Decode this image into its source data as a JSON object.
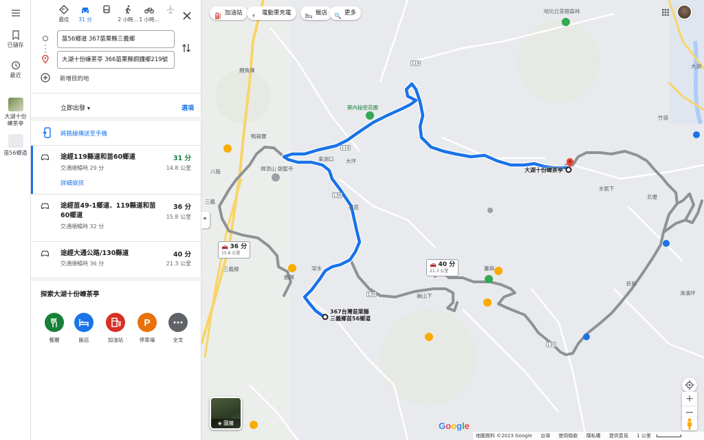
{
  "rail": {
    "saved": "已儲存",
    "recent": "最近",
    "recent_place_1": "大湖十份\n崠茶亭",
    "recent_place_2": "苗56鄉道"
  },
  "modes": [
    {
      "label": "最佳",
      "icon": "diamond-route-icon"
    },
    {
      "label": "31 分",
      "icon": "car-icon",
      "active": true
    },
    {
      "label": "",
      "icon": "bus-icon"
    },
    {
      "label": "2 小時...",
      "icon": "walk-icon"
    },
    {
      "label": "1 小時...",
      "icon": "bike-icon"
    },
    {
      "label": "",
      "icon": "plane-icon"
    }
  ],
  "waypoints": {
    "origin": "苗56鄉道 367苗栗縣三義鄉",
    "destination": "大湖十份崠茶亭 366苗栗縣銅鑼鄉219號",
    "add_destination": "新增目的地"
  },
  "depart": "立即出發",
  "options": "選項",
  "send_to_phone": "將路線傳送至手機",
  "routes": [
    {
      "title": "途經119縣道和苗60鄉道",
      "time": "31 分",
      "sub": "交通順暢時 29 分",
      "dist": "14.8 公里",
      "details": "詳細資訊"
    },
    {
      "title": "途經苗49-1鄉道、119縣道和苗60鄉道",
      "time": "36 分",
      "sub": "交通順暢時 32 分",
      "dist": "15.8 公里"
    },
    {
      "title": "途經大通公路/130縣道",
      "time": "40 分",
      "sub": "交通順暢時 36 分",
      "dist": "21.3 公里"
    }
  ],
  "explore": {
    "title": "探索大湖十份崠茶亭",
    "items": [
      {
        "label": "餐廳",
        "color": "#188038"
      },
      {
        "label": "飯店",
        "color": "#1a73e8"
      },
      {
        "label": "加油站",
        "color": "#d93025"
      },
      {
        "label": "停車場",
        "color": "#e8710a"
      },
      {
        "label": "全文",
        "color": "#5f6368"
      }
    ]
  },
  "chips": [
    "加油站",
    "電動車充電",
    "飯店",
    "更多"
  ],
  "map": {
    "labels": {
      "forest": "哈比丘茶樹森林",
      "garden": "葵內秘密花園",
      "temple": "佛頂山 朝聖寺",
      "cafe": "鴨箱寶",
      "dapi": "大坪",
      "shiding": "石底",
      "shenshui": "深水",
      "sanyi": "三義",
      "sanyixiang": "三義鄉",
      "bali": "八股",
      "shengxing": "勝興",
      "lianshanxia": "崩山下",
      "xinglong": "竹嶺",
      "shuiqixia": "水氣下",
      "beixia": "北壢",
      "minhe": "民和",
      "linxi": "淋漓坪",
      "daxue": "大湖",
      "lingding": "薑麻",
      "dongmian": "鯉魚潭",
      "huxi": "東湖口"
    },
    "route_boxes": [
      {
        "time": "36 分",
        "dist": "15.8 公里"
      },
      {
        "time": "40 分",
        "dist": "21.3 公里"
      }
    ],
    "start_label": "367台灣苗栗縣\n三義鄉苗56鄉道",
    "end_label": "大湖十份崠茶亭",
    "shields": [
      "119",
      "119",
      "130",
      "130",
      "130"
    ],
    "layers": "圖層",
    "google": "Google",
    "footer": [
      "地圖資料 ©2023 Google",
      "台灣",
      "使用條款",
      "隱私權",
      "提供意見",
      "1 公里"
    ]
  },
  "colors": {
    "primary_route": "#1a73e8",
    "alt_route": "#8e9296",
    "map_bg": "#e8eaed"
  }
}
